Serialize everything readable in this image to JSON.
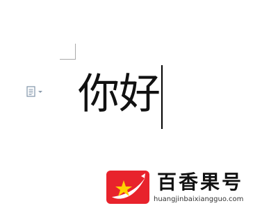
{
  "document": {
    "text": "你好"
  },
  "icons": {
    "paste_options": "paste-options-icon",
    "dropdown": "chevron-down-icon"
  },
  "watermark": {
    "title": "百香果号",
    "url": "huangjinbaixiangguo.com",
    "logo_colors": {
      "background": "#e8232c",
      "star": "#ffd200",
      "swoosh": "#ffffff"
    }
  },
  "colors": {
    "page_background": "#ffffff",
    "text": "#111111",
    "margin_guide": "#a9a9a9",
    "icon": "#7f93a8"
  }
}
